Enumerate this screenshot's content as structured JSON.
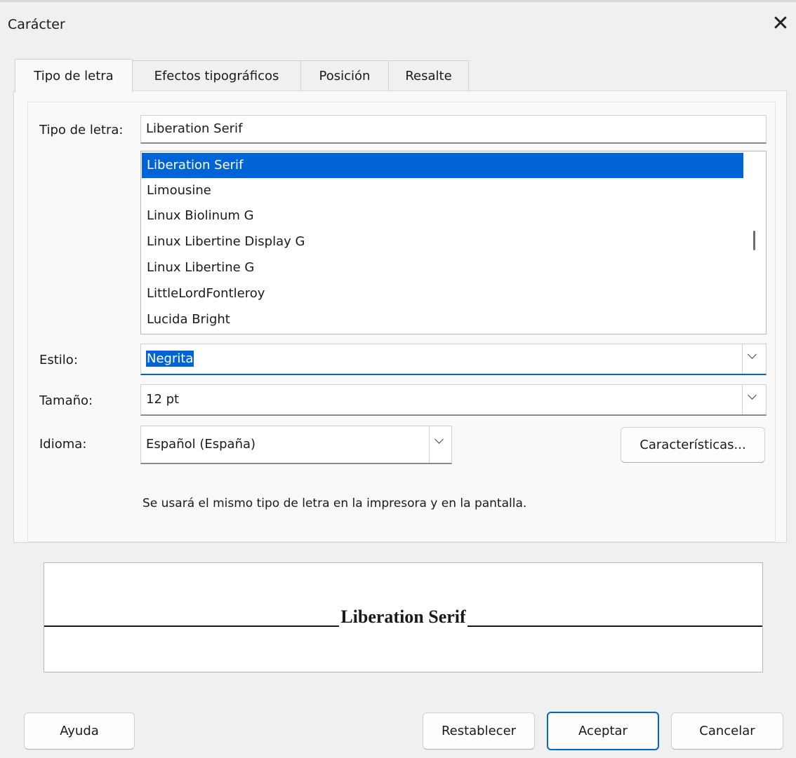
{
  "window": {
    "title": "Carácter",
    "close_icon": "✕"
  },
  "tabs": [
    {
      "label": "Tipo de letra",
      "active": true
    },
    {
      "label": "Efectos tipográficos",
      "active": false
    },
    {
      "label": "Posición",
      "active": false
    },
    {
      "label": "Resalte",
      "active": false
    }
  ],
  "font": {
    "label": "Tipo de letra:",
    "value": "Liberation Serif",
    "list": [
      "Liberation Serif",
      "Limousine",
      "Linux Biolinum G",
      "Linux Libertine Display G",
      "Linux Libertine G",
      "LittleLordFontleroy",
      "Lucida Bright"
    ],
    "selected_index": 0
  },
  "style": {
    "label": "Estilo:",
    "value": "Negrita"
  },
  "size": {
    "label": "Tamaño:",
    "value": "12 pt"
  },
  "language": {
    "label": "Idioma:",
    "value": "Español (España)"
  },
  "features_button": "Características...",
  "note": "Se usará el mismo tipo de letra en la impresora y en la pantalla.",
  "preview": {
    "text": "Liberation Serif"
  },
  "buttons": {
    "help": "Ayuda",
    "reset": "Restablecer",
    "ok": "Aceptar",
    "cancel": "Cancelar"
  },
  "colors": {
    "accent": "#0063d6",
    "background": "#f0f0f0",
    "panel": "#f9f9f9"
  }
}
